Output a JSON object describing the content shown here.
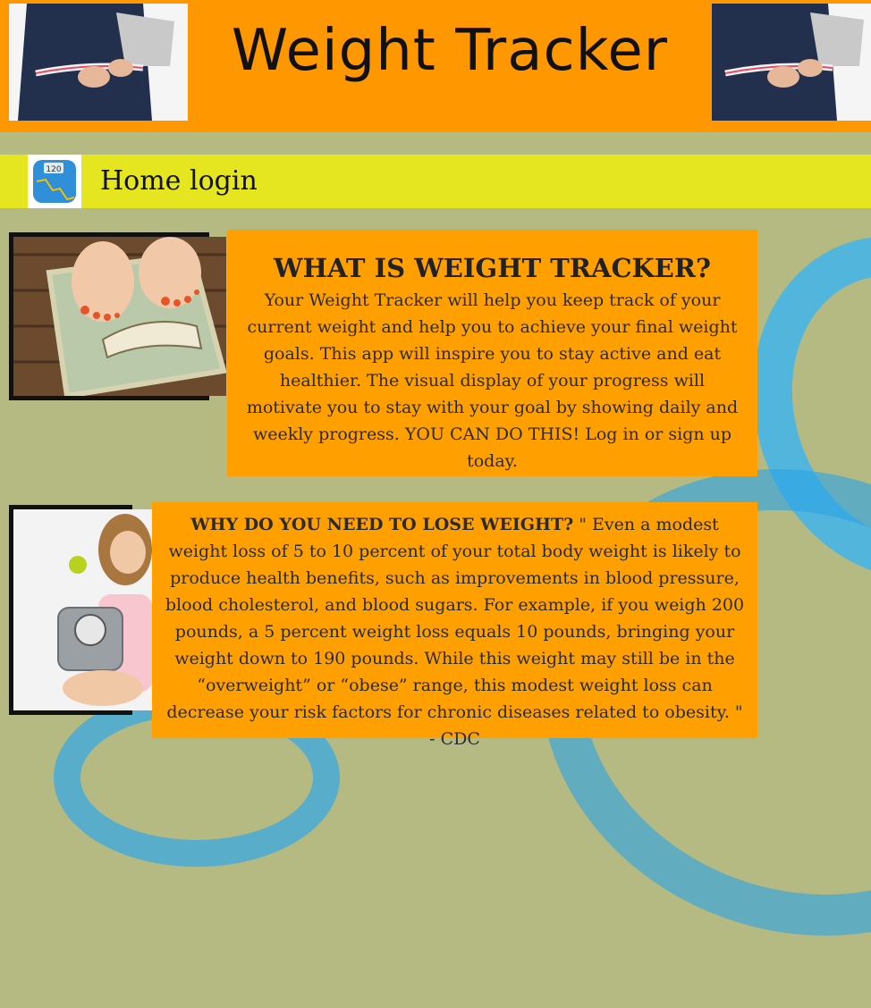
{
  "header": {
    "title": "Weight Tracker"
  },
  "nav": {
    "app_icon_reading": "120",
    "items": [
      {
        "label": "Home"
      },
      {
        "label": "login"
      }
    ]
  },
  "section1": {
    "heading": "WHAT IS WEIGHT TRACKER?",
    "body": "Your Weight Tracker will help you keep track of your current weight and help you to achieve your final weight goals. This app will inspire you to stay active and eat healthier. The visual display of your progress will motivate you to stay with your goal by showing daily and weekly progress. YOU CAN DO THIS! Log in or sign up today."
  },
  "section2": {
    "heading": "WHY DO YOU NEED TO LOSE WEIGHT?",
    "body": " \" Even a modest weight loss of 5 to 10 percent of your total body weight is likely to produce health benefits, such as improvements in blood pressure, blood cholesterol, and blood sugars. For example, if you weigh 200 pounds, a 5 percent weight loss equals 10 pounds, bringing your weight down to 190 pounds. While this weight may still be in the “overweight” or “obese” range, this modest weight loss can decrease your risk factors for chronic diseases related to obesity. \" - CDC"
  },
  "colors": {
    "page_background": "#b5ba82",
    "header_orange": "#ff9800",
    "nav_yellow": "#e6e620",
    "card_orange": "#ffa000"
  }
}
